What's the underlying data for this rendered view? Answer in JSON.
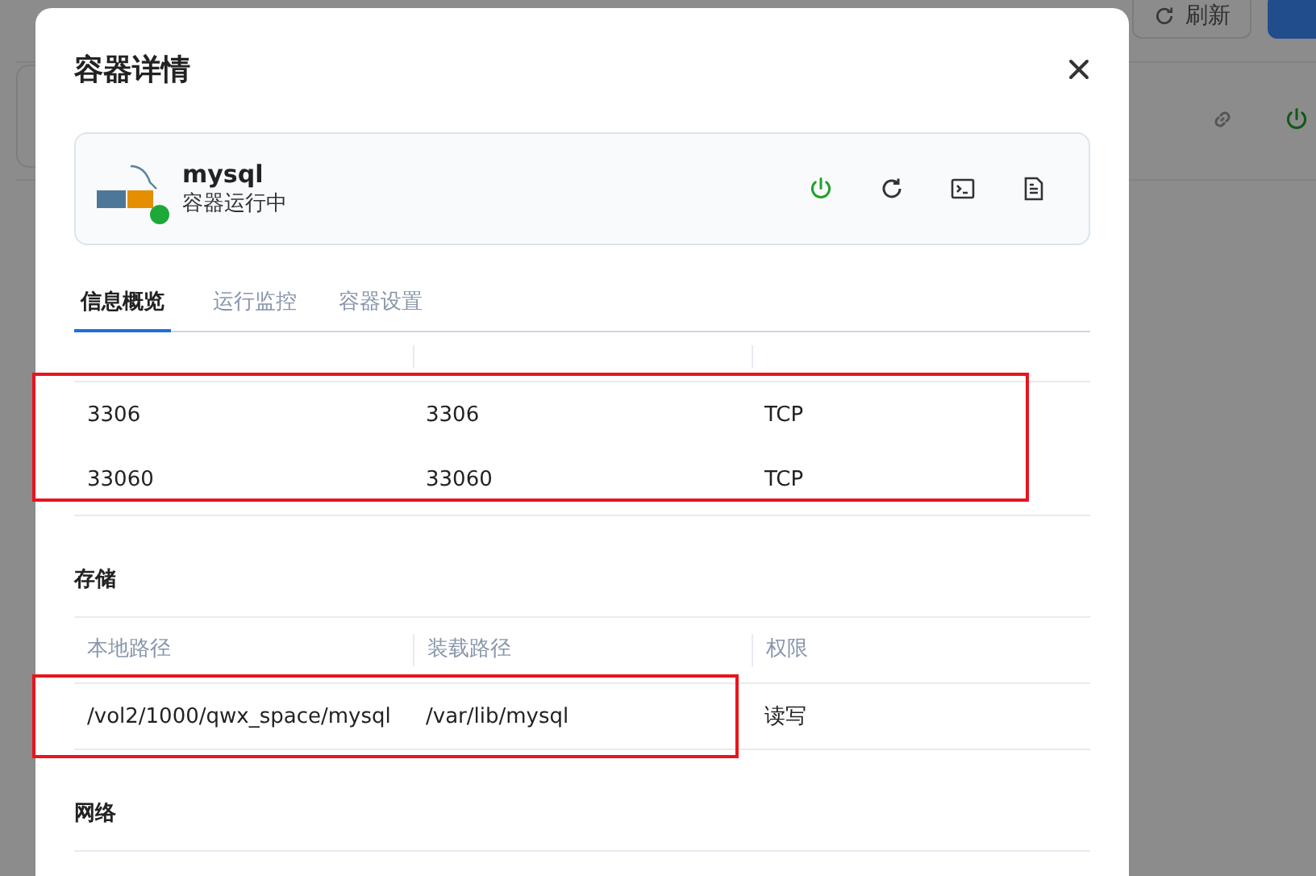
{
  "background": {
    "refresh_button": "刷新"
  },
  "dialog": {
    "title": "容器详情",
    "container": {
      "name": "mysql",
      "status": "容器运行中",
      "running": true
    },
    "tabs": [
      {
        "label": "信息概览",
        "selected": true
      },
      {
        "label": "运行监控",
        "selected": false
      },
      {
        "label": "容器设置",
        "selected": false
      }
    ],
    "ports_table": {
      "highlighted": true,
      "rows": [
        {
          "cells": [
            "3306",
            "3306",
            "TCP"
          ]
        },
        {
          "cells": [
            "33060",
            "33060",
            "TCP"
          ]
        }
      ]
    },
    "storage": {
      "heading": "存储",
      "highlighted": true,
      "columns": [
        "本地路径",
        "装载路径",
        "权限"
      ],
      "rows": [
        {
          "cells": [
            "/vol2/1000/qwx_space/mysql",
            "/var/lib/mysql",
            "读写"
          ]
        }
      ]
    },
    "network": {
      "heading": "网络"
    }
  }
}
